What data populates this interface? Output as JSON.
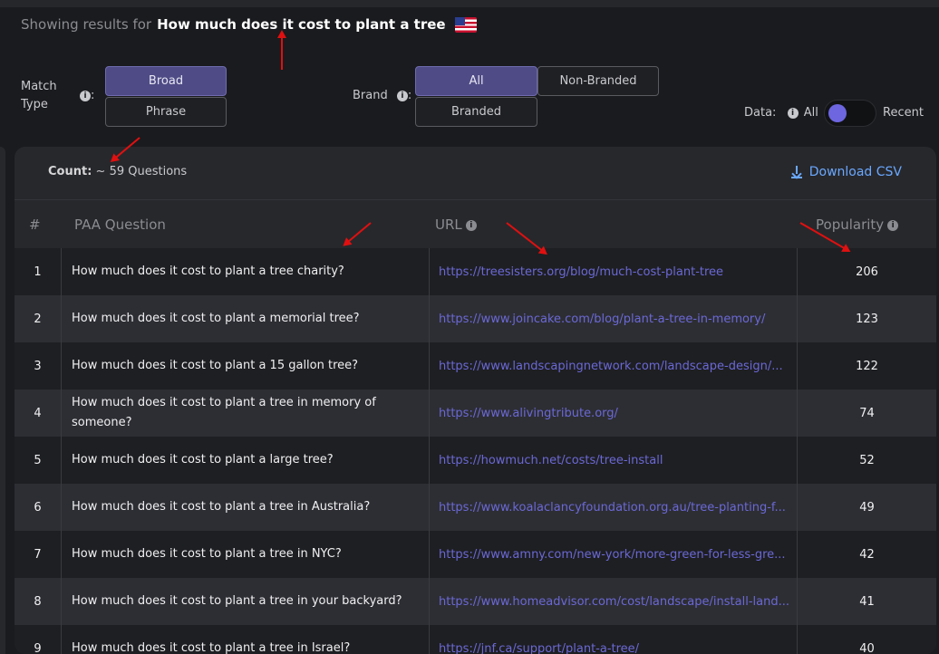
{
  "header": {
    "prefix": "Showing results for",
    "query": "How much does it cost to plant a tree"
  },
  "filters": {
    "match_type_label": "Match Type",
    "match_type_options": [
      "Broad",
      "Phrase"
    ],
    "match_type_selected": "Broad",
    "brand_label": "Brand",
    "brand_options": [
      "All",
      "Non-Branded",
      "Branded"
    ],
    "brand_selected": "All",
    "data_label": "Data:",
    "data_all": "All",
    "data_recent": "Recent"
  },
  "summary": {
    "count_label": "Count:",
    "count_value": "~ 59 Questions",
    "download_label": "Download CSV"
  },
  "table": {
    "columns": [
      "#",
      "PAA Question",
      "URL",
      "Popularity"
    ],
    "rows": [
      {
        "num": "1",
        "question": "How much does it cost to plant a tree charity?",
        "url": "https://treesisters.org/blog/much-cost-plant-tree",
        "popularity": "206"
      },
      {
        "num": "2",
        "question": "How much does it cost to plant a memorial tree?",
        "url": "https://www.joincake.com/blog/plant-a-tree-in-memory/",
        "popularity": "123"
      },
      {
        "num": "3",
        "question": "How much does it cost to plant a 15 gallon tree?",
        "url": "https://www.landscapingnetwork.com/landscape-design/...",
        "popularity": "122"
      },
      {
        "num": "4",
        "question": "How much does it cost to plant a tree in memory of someone?",
        "url": "https://www.alivingtribute.org/",
        "popularity": "74"
      },
      {
        "num": "5",
        "question": "How much does it cost to plant a large tree?",
        "url": "https://howmuch.net/costs/tree-install",
        "popularity": "52"
      },
      {
        "num": "6",
        "question": "How much does it cost to plant a tree in Australia?",
        "url": "https://www.koalaclancyfoundation.org.au/tree-planting-f...",
        "popularity": "49"
      },
      {
        "num": "7",
        "question": "How much does it cost to plant a tree in NYC?",
        "url": "https://www.amny.com/new-york/more-green-for-less-gre...",
        "popularity": "42"
      },
      {
        "num": "8",
        "question": "How much does it cost to plant a tree in your backyard?",
        "url": "https://www.homeadvisor.com/cost/landscape/install-land...",
        "popularity": "41"
      },
      {
        "num": "9",
        "question": "How much does it cost to plant a tree in Israel?",
        "url": "https://jnf.ca/support/plant-a-tree/",
        "popularity": "40"
      }
    ]
  },
  "colors": {
    "accent": "#4f4b86",
    "link": "#6b68d6",
    "download": "#6aa8ff",
    "annotation_arrow": "#e01010"
  }
}
